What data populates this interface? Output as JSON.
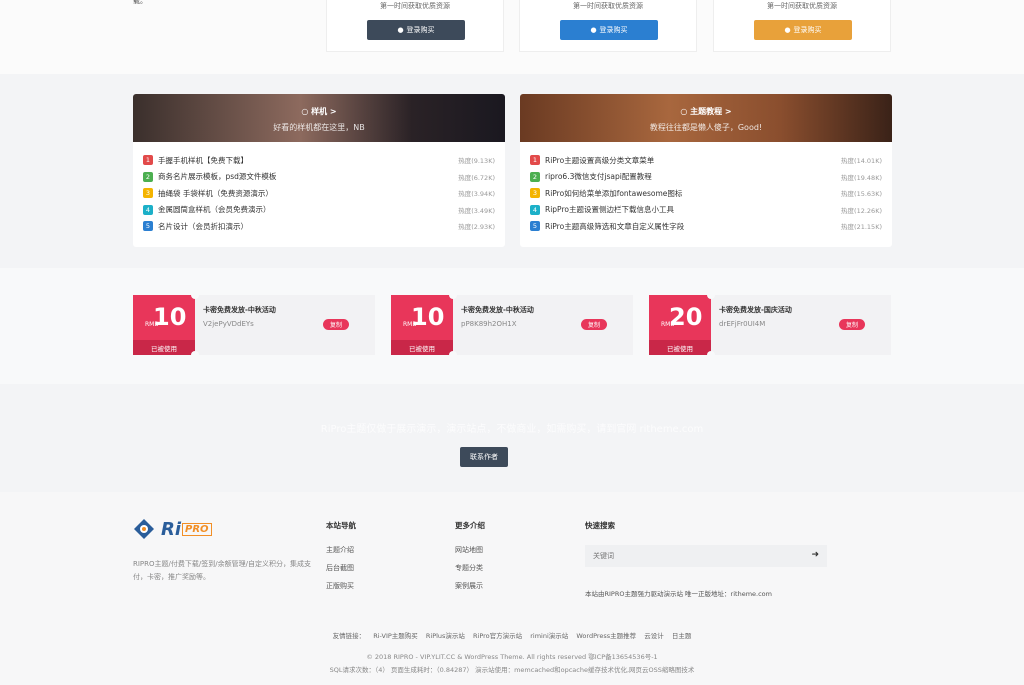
{
  "top": {
    "left_text": "载。",
    "plans": [
      {
        "desc": "第一时间获取优质资源",
        "btn": "登录购买",
        "color": "#3d4a5a"
      },
      {
        "desc": "第一时间获取优质资源",
        "btn": "登录购买",
        "color": "#2b7fd1"
      },
      {
        "desc": "第一时间获取优质资源",
        "btn": "登录购买",
        "color": "#e8a13a"
      }
    ]
  },
  "categories": [
    {
      "title": "样机 >",
      "subtitle": "好看的样机都在这里，NB",
      "items": [
        {
          "num": "1",
          "title": "手握手机样机【免费下载】",
          "hot": "热度(9.13K)",
          "color": "#e24a4a"
        },
        {
          "num": "2",
          "title": "商务名片展示模板，psd源文件模板",
          "hot": "热度(6.72K)",
          "color": "#4caf50"
        },
        {
          "num": "3",
          "title": "抽绳袋 手袋样机（免费资源演示）",
          "hot": "热度(3.94K)",
          "color": "#f4b400"
        },
        {
          "num": "4",
          "title": "金属圆筒盒样机（会员免费演示）",
          "hot": "热度(3.49K)",
          "color": "#1cb0c8"
        },
        {
          "num": "5",
          "title": "名片设计（会员折扣演示）",
          "hot": "热度(2.93K)",
          "color": "#2b7fd1"
        }
      ]
    },
    {
      "title": "主题教程 >",
      "subtitle": "教程往往都是懒人傻子，Good!",
      "items": [
        {
          "num": "1",
          "title": "RiPro主题设置高级分类文章菜单",
          "hot": "热度(14.01K)",
          "color": "#e24a4a"
        },
        {
          "num": "2",
          "title": "ripro6.3微信支付jsapi配置教程",
          "hot": "热度(19.48K)",
          "color": "#4caf50"
        },
        {
          "num": "3",
          "title": "RiPro如何给菜单添加fontawesome图标",
          "hot": "热度(15.63K)",
          "color": "#f4b400"
        },
        {
          "num": "4",
          "title": "RipPro主题设置侧边栏下载信息小工具",
          "hot": "热度(12.26K)",
          "color": "#1cb0c8"
        },
        {
          "num": "5",
          "title": "RiPro主题高级筛选和文章自定义属性字段",
          "hot": "热度(21.15K)",
          "color": "#2b7fd1"
        }
      ]
    }
  ],
  "coupons": [
    {
      "currency": "RMB",
      "amount": "10",
      "title": "卡密免费发放-中秋活动",
      "code": "V2jePyVDdEYs",
      "btn": "复制",
      "used": "已被使用"
    },
    {
      "currency": "RMB",
      "amount": "10",
      "title": "卡密免费发放-中秋活动",
      "code": "pP8K89h2OH1X",
      "btn": "复制",
      "used": "已被使用"
    },
    {
      "currency": "RMB",
      "amount": "20",
      "title": "卡密免费发放-国庆活动",
      "code": "drEFjFr0UI4M",
      "btn": "复制",
      "used": "已被使用"
    }
  ],
  "cta": {
    "text": "RiPro主题仅做于展示演示，演示站点，不做商业，如需购买，请到官网 ritheme.com",
    "btn": "联系作者"
  },
  "footer": {
    "logo_ri": "Ri",
    "logo_pro": "PRO",
    "desc": "RIPRO主题/付费下载/签到/余额管理/自定义积分，集成支付，卡密，推广奖励等。",
    "nav_title": "本站导航",
    "nav_links": [
      "主题介绍",
      "后台截图",
      "正版购买"
    ],
    "more_title": "更多介绍",
    "more_links": [
      "网站地图",
      "专题分类",
      "案例展示"
    ],
    "search_title": "快速搜索",
    "search_placeholder": "关键词",
    "notice": "本站由RIPRO主题强力驱动演示站 唯一正版地址：ritheme.com",
    "links_label": "友情链接：",
    "friend_links": [
      "Ri-VIP主题购买",
      "RiPlus演示站",
      "RiPro官方演示站",
      "rimini演示站",
      "WordPress主题推荐",
      "云设计",
      "日主题"
    ],
    "copyright": "© 2018 RIPRO - VIP.YLIT.CC & WordPress Theme. All rights reserved  鄂ICP备13654536号-1",
    "stats": "SQL请求次数：（4） 页面生成耗时：（0.84287） 演示站使用：memcached和opcache缓存技术优化,网页云OSS缩略图技术"
  }
}
